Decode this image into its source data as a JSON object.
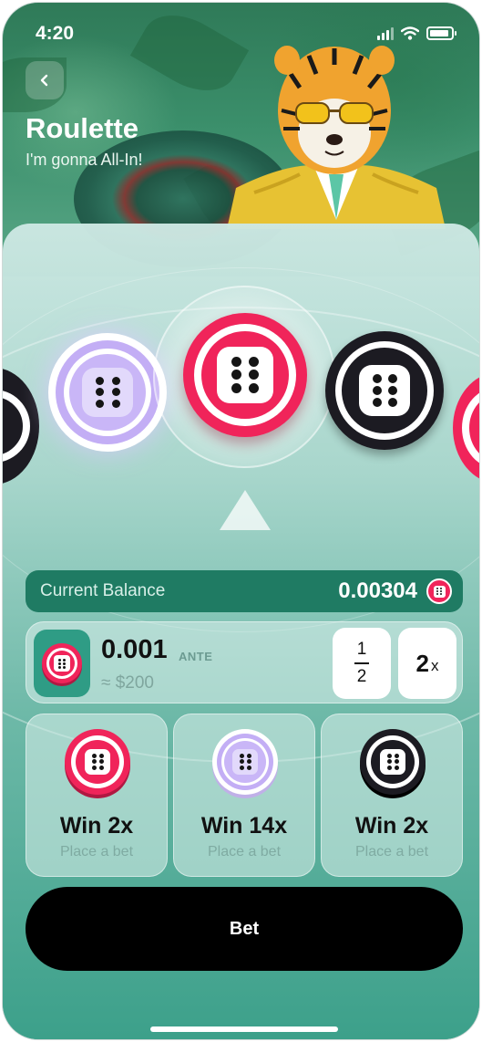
{
  "status_bar": {
    "time": "4:20"
  },
  "header": {
    "title": "Roulette",
    "subtitle": "I'm gonna All-In!"
  },
  "colors": {
    "red": "#f0245a",
    "purple": "#b89bf0",
    "black": "#1c1b22",
    "green": "#1f7b63"
  },
  "carousel": {
    "chips": [
      "black-chip",
      "purple-chip",
      "red-chip",
      "black-chip",
      "red-chip"
    ],
    "selected": "red-chip"
  },
  "balance": {
    "label": "Current Balance",
    "value": "0.00304"
  },
  "bet": {
    "amount": "0.001",
    "unit": "ANTE",
    "usd": "≈ $200",
    "half_top": "1",
    "half_bottom": "2",
    "double_value": "2",
    "double_suffix": "x"
  },
  "options": [
    {
      "title": "Win 2x",
      "subtitle": "Place a bet",
      "chip": "red-chip"
    },
    {
      "title": "Win 14x",
      "subtitle": "Place a bet",
      "chip": "purple-chip"
    },
    {
      "title": "Win 2x",
      "subtitle": "Place a bet",
      "chip": "black-chip"
    }
  ],
  "actions": {
    "bet_label": "Bet"
  }
}
